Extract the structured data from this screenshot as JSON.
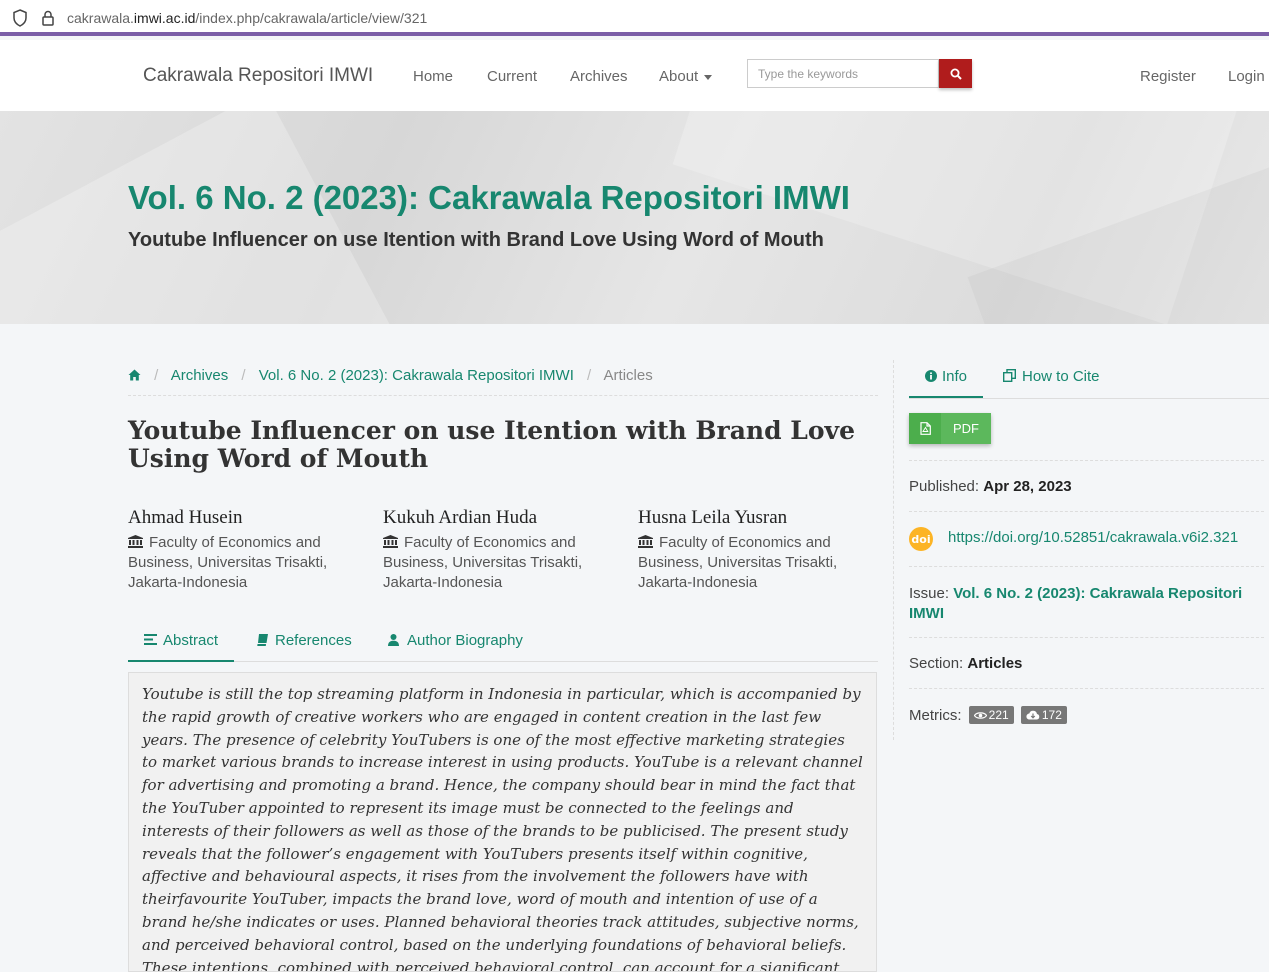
{
  "browser": {
    "url_prefix": "cakrawala.",
    "url_host": "imwi.ac.id",
    "url_path": "/index.php/cakrawala/article/view/321"
  },
  "navbar": {
    "brand": "Cakrawala Repositori IMWI",
    "links": [
      "Home",
      "Current",
      "Archives",
      "About"
    ],
    "search_placeholder": "Type the keywords",
    "register": "Register",
    "login": "Login"
  },
  "hero": {
    "title": "Vol. 6 No. 2 (2023): Cakrawala Repositori IMWI",
    "subtitle": "Youtube Influencer on use Itention with Brand Love Using Word of Mouth"
  },
  "breadcrumb": {
    "archives": "Archives",
    "issue": "Vol. 6 No. 2 (2023): Cakrawala Repositori IMWI",
    "current": "Articles"
  },
  "article": {
    "title": "Youtube Influencer on use Itention with Brand Love Using Word of Mouth",
    "authors": [
      {
        "name": "Ahmad Husein",
        "affiliation": "Faculty of Economics and Business, Universitas Trisakti, Jakarta-Indonesia"
      },
      {
        "name": "Kukuh Ardian Huda",
        "affiliation": "Faculty of Economics and Business, Universitas Trisakti, Jakarta-Indonesia"
      },
      {
        "name": "Husna Leila Yusran",
        "affiliation": "Faculty of Economics and Business, Universitas Trisakti, Jakarta-Indonesia"
      }
    ],
    "tabs": [
      "Abstract",
      "References",
      "Author Biography"
    ],
    "abstract": "Youtube is still the top streaming platform in Indonesia in particular, which is accompanied by the rapid growth of creative workers who are engaged in content creation in the last few years. The presence of celebrity YouTubers is one of the most effective marketing strategies to market various brands to increase interest in using products. YouTube is a relevant channel for advertising and promoting a brand. Hence, the company should bear in mind the fact that the YouTuber appointed to represent its image must be connected to the feelings and interests of their followers as well as those of the brands to be publicised. The present study reveals that the follower’s engagement with YouTubers presents itself within cognitive, affective and behavioural aspects, it rises from the involvement the followers have with theirfavourite YouTuber, impacts the brand love, word of mouth and intention of use of a brand he/she indicates or uses. Planned behavioral theories track attitudes, subjective norms, and perceived behavioral control, based on the underlying foundations of behavioral beliefs. These intentions, combined with perceived behavioral control, can account for a significant proportion of behavioral change in planned behavior theory. the problem is"
  },
  "sidebar": {
    "tab_info": "Info",
    "tab_cite": "How to Cite",
    "pdf_label": "PDF",
    "published_label": "Published:",
    "published_date": "Apr 28, 2023",
    "doi_icon_text": "doi",
    "doi_url": "https://doi.org/10.52851/cakrawala.v6i2.321",
    "issue_label": "Issue:",
    "issue_line1": "Vol. 6 No. 2 (2023): Cakrawala Repositori",
    "issue_line2": "IMWI",
    "section_label": "Section:",
    "section_value": "Articles",
    "metrics_label": "Metrics:",
    "views": "221",
    "downloads": "172"
  },
  "colors": {
    "accent": "#17876f",
    "search_button": "#b01c1c",
    "pdf_button": "#5cb85c",
    "browser_border": "#7b5ea7"
  }
}
